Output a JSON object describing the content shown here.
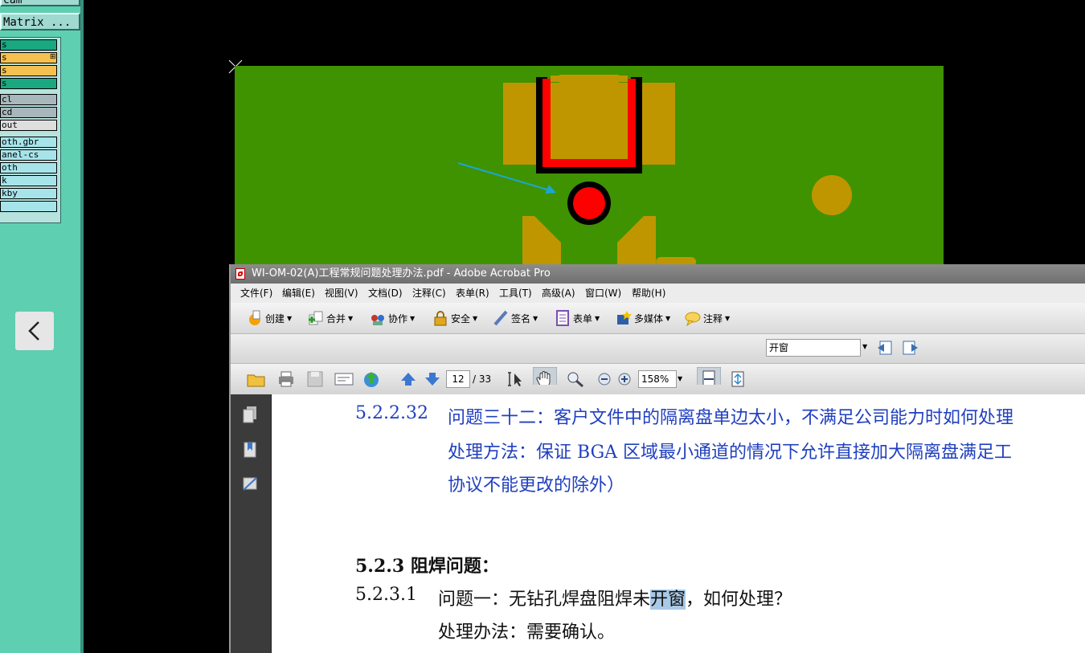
{
  "cam": {
    "title": "cam",
    "matrix_button": "Matrix ...",
    "layers": [
      {
        "label": "s",
        "color": "#19a880",
        "mark": ""
      },
      {
        "label": "s",
        "color": "#f5c04f",
        "mark": "⊞"
      },
      {
        "label": "s",
        "color": "#f5c04f",
        "mark": ""
      },
      {
        "label": "s",
        "color": "#19a880",
        "mark": ""
      },
      {
        "label": "cl",
        "color": "#a7b7bb",
        "mark": ""
      },
      {
        "label": "cd",
        "color": "#a7b7bb",
        "mark": ""
      },
      {
        "label": "out",
        "color": "#dedede",
        "mark": ""
      },
      {
        "label": "oth.gbr",
        "color": "#a6e4ea",
        "mark": ""
      },
      {
        "label": "anel-cs",
        "color": "#a6e4ea",
        "mark": ""
      },
      {
        "label": "oth",
        "color": "#a6e4ea",
        "mark": ""
      },
      {
        "label": "k",
        "color": "#a6e4ea",
        "mark": ""
      },
      {
        "label": "kby",
        "color": "#a6e4ea",
        "mark": ""
      },
      {
        "label": "",
        "color": "#a6e4ea",
        "mark": ""
      }
    ]
  },
  "nav": {
    "prev_icon": "chevron-left-icon",
    "next_icon": "chevron-right-icon"
  },
  "acrobat": {
    "title": "WI-OM-02(A)工程常规问题处理办法.pdf - Adobe Acrobat Pro",
    "menu": [
      "文件(F)",
      "编辑(E)",
      "视图(V)",
      "文档(D)",
      "注释(C)",
      "表单(R)",
      "工具(T)",
      "高级(A)",
      "窗口(W)",
      "帮助(H)"
    ],
    "tasks": [
      "创建",
      "合并",
      "协作",
      "安全",
      "签名",
      "表单",
      "多媒体",
      "注释"
    ],
    "find_value": "开窗",
    "page_current": "12",
    "page_total": "/ 33",
    "zoom": "158%"
  },
  "document": {
    "l1_num": "5.2.2.32",
    "l1_text": "问题三十二：客户文件中的隔离盘单边太小，不满足公司能力时如何处理",
    "l2_text": "处理方法：保证 BGA 区域最小通道的情况下允许直接加大隔离盘满足工",
    "l3_text": "协议不能更改的除外）",
    "heading": "5.2.3 阻焊问题：",
    "q1_num": "5.2.3.1",
    "q1_pre": "问题一：无钻孔焊盘阻焊未",
    "q1_hl": "开窗",
    "q1_post": "，如何处理？",
    "a1": "处理办法：需要确认。"
  }
}
